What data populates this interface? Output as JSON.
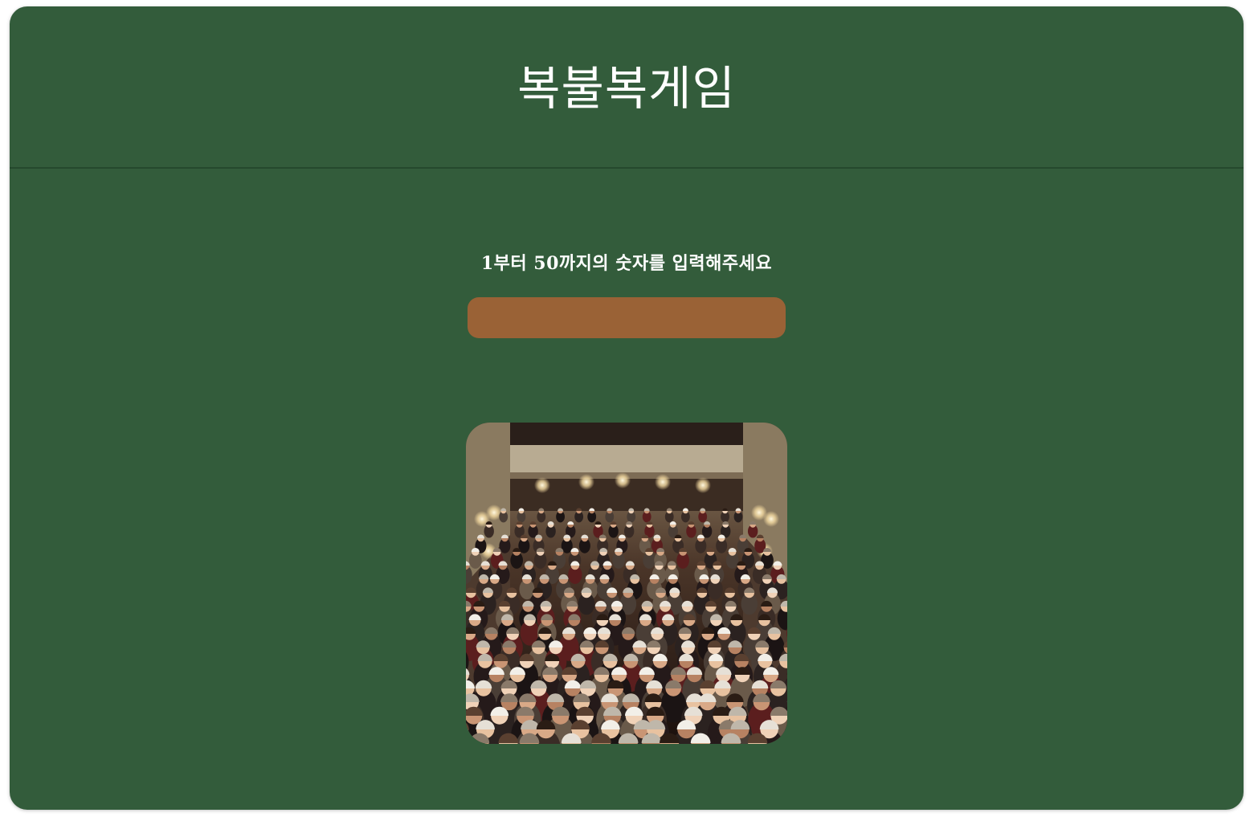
{
  "header": {
    "title": "복불복게임"
  },
  "main": {
    "prompt": "1부터 50까지의 숫자를 입력해주세요",
    "number_input": {
      "value": "",
      "placeholder": ""
    },
    "image": {
      "subject": "audience-applause-photo"
    }
  },
  "colors": {
    "background": "#335c3b",
    "input_fill": "#9a6236",
    "text": "#ffffff"
  }
}
